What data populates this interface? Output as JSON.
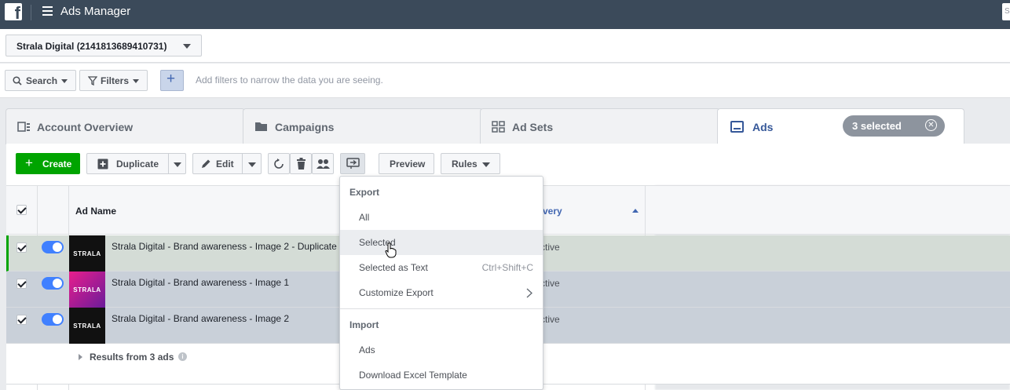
{
  "topbar": {
    "title": "Ads Manager",
    "search_placeholder": "S"
  },
  "account": {
    "name": "Strala Digital (2141813689410731)"
  },
  "filters": {
    "search_label": "Search",
    "filters_label": "Filters",
    "hint": "Add filters to narrow the data you are seeing."
  },
  "tabs": [
    {
      "label": "Account Overview"
    },
    {
      "label": "Campaigns"
    },
    {
      "label": "Ad Sets"
    },
    {
      "label": "Ads"
    }
  ],
  "selection_badge": "3 selected",
  "toolbar": {
    "create": "Create",
    "duplicate": "Duplicate",
    "edit": "Edit",
    "preview": "Preview",
    "rules": "Rules"
  },
  "table": {
    "col_ad_name": "Ad Name",
    "col_delivery_partial": "very",
    "rows": [
      {
        "name": "Strala Digital - Brand awareness - Image 2 - Duplicate",
        "delivery": "ctive",
        "thumb": "STRALA"
      },
      {
        "name": "Strala Digital - Brand awareness - Image 1",
        "delivery": "ctive",
        "thumb": "STRALA"
      },
      {
        "name": "Strala Digital - Brand awareness - Image 2",
        "delivery": "ctive",
        "thumb": "STRALA"
      }
    ],
    "results": "Results from 3 ads"
  },
  "menu": {
    "export_heading": "Export",
    "items_export": [
      {
        "label": "All"
      },
      {
        "label": "Selected"
      },
      {
        "label": "Selected as Text",
        "shortcut": "Ctrl+Shift+C"
      },
      {
        "label": "Customize Export"
      }
    ],
    "import_heading": "Import",
    "items_import": [
      {
        "label": "Ads"
      },
      {
        "label": "Download Excel Template"
      }
    ]
  },
  "colors": {
    "topbar": "#3b4a5a",
    "create_green": "#00a400",
    "toggle_blue": "#4080ff",
    "link_blue": "#365899"
  }
}
